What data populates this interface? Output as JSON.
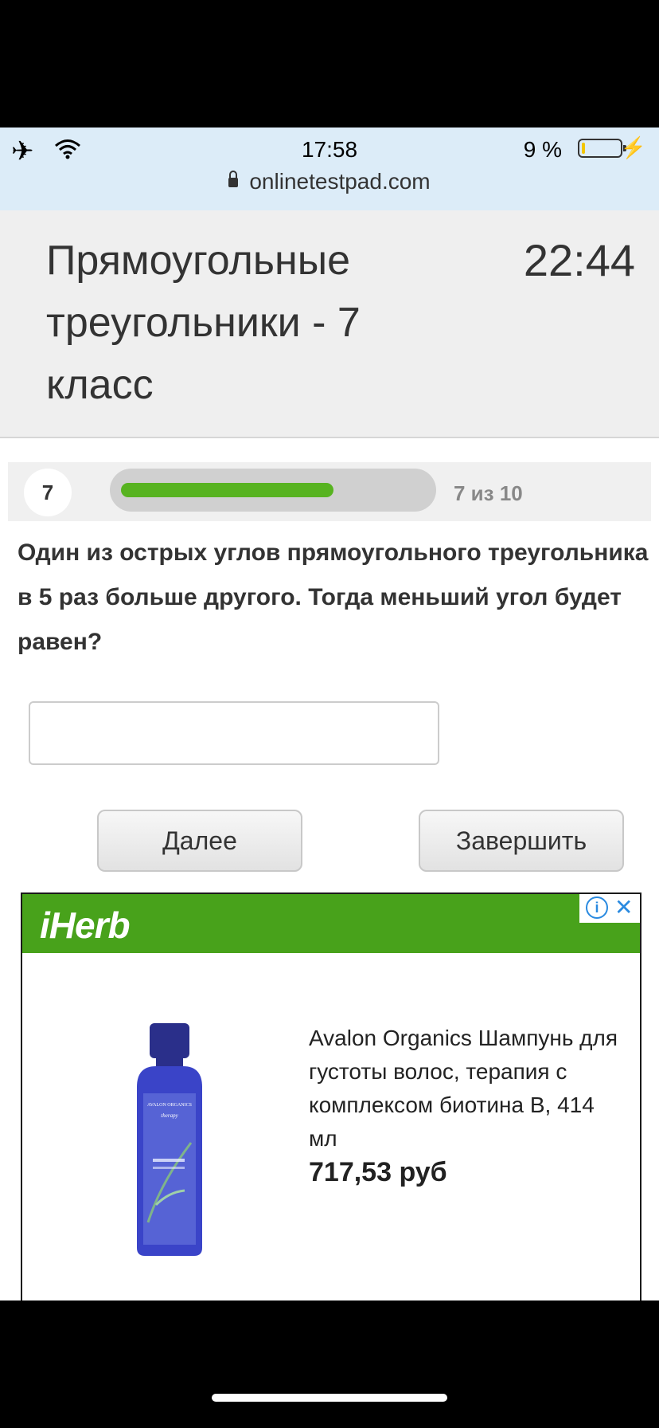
{
  "status_bar": {
    "time": "17:58",
    "battery": "9 %",
    "battery_level": 0.09,
    "url": "onlinetestpad.com"
  },
  "header": {
    "title": "Прямоугольные треугольники - 7 класс",
    "timer": "22:44"
  },
  "progress": {
    "question_number": "7",
    "counter": "7 из 10",
    "fraction": 0.7,
    "bar_color": "#57b320"
  },
  "question": {
    "text": "Один из острых углов прямоугольного треугольника в 5 раз больше другого. Тогда меньший угол будет равен?"
  },
  "answer": {
    "value": ""
  },
  "buttons": {
    "next": "Далее",
    "finish": "Завершить"
  },
  "ad": {
    "brand": "iHerb",
    "brand_color": "#48a21b",
    "product_name": "Avalon Organics Шампунь для густоты волос, терапия с комплексом биотина B, 414 мл",
    "price": "717,53 руб",
    "bottle_label": "AVALON ORGANICS",
    "bottle_sub": "therapy",
    "info_icon": "info-icon",
    "close_icon": "close-icon"
  }
}
